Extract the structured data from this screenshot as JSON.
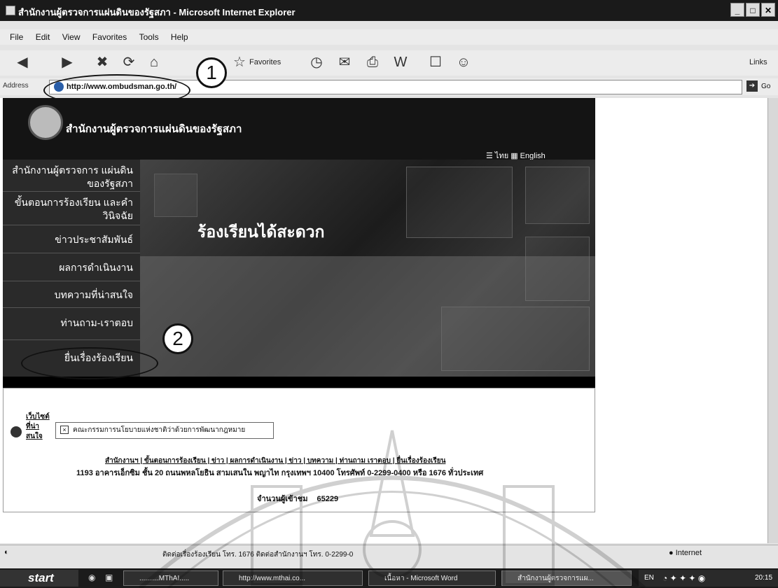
{
  "window": {
    "title": "สำนักงานผู้ตรวจการแผ่นดินของรัฐสภา - Microsoft Internet Explorer"
  },
  "menu": [
    "File",
    "Edit",
    "View",
    "Favorites",
    "Tools",
    "Help"
  ],
  "toolbar": {
    "favorites_label": "Favorites",
    "links_label": "Links"
  },
  "address": {
    "label": "Address",
    "url": "http://www.ombudsman.go.th/",
    "go_label": "Go"
  },
  "annotations": {
    "one": "1",
    "two": "2"
  },
  "site": {
    "name": "สำนักงานผู้ตรวจการแผ่นดินของรัฐสภา",
    "lang_thai": "ไทย",
    "lang_english": "English",
    "nav": [
      "สำนักงานผู้ตรวจการ แผ่นดินของรัฐสภา",
      "ขั้นตอนการร้องเรียน และคำวินิจฉัย",
      "ข่าวประชาสัมพันธ์",
      "ผลการดำเนินงาน",
      "บทความที่น่าสนใจ",
      "ท่านถาม-เราตอบ",
      "ยื่นเรื่องร้องเรียน"
    ],
    "hero_text": "ร้องเรียนได้สะดวก",
    "footer": {
      "vertical_link": "เว็บไซต์ที่น่าสนใจ",
      "box_text": "คณะกรรมการนโยบายแห่งชาติว่าด้วยการพัฒนากฎหมาย",
      "links_line": "สำนักงานฯ | ขั้นตอนการร้องเรียน | ข่าว | ผลการดำเนินงาน | ข่าว | บทความ | ท่านถาม เราตอบ | ยื่นเรื่องร้องเรียน",
      "address_line": "1193 อาคารเอ็กซิม ชั้น 20 ถนนพหลโยธิน สามเสนใน พญาไท กรุงเทพฯ 10400 โทรศัพท์ 0-2299-0400 หรือ 1676 ทั่วประเทศ",
      "visitor_label": "จำนวนผู้เข้าชม",
      "visitor_count": "65229"
    }
  },
  "status": {
    "message": "ติดต่อเรื่องร้องเรียน โทร. 1676 ติดต่อสำนักงานฯ โทร. 0-2299-0",
    "zone": "Internet"
  },
  "taskbar": {
    "start": "start",
    "items": [
      "..........MThAI.....",
      "http://www.mthai.co...",
      "เนื้อหา - Microsoft Word",
      "สำนักงานผู้ตรวจการแผ..."
    ],
    "lang": "EN",
    "clock": "20:15"
  }
}
